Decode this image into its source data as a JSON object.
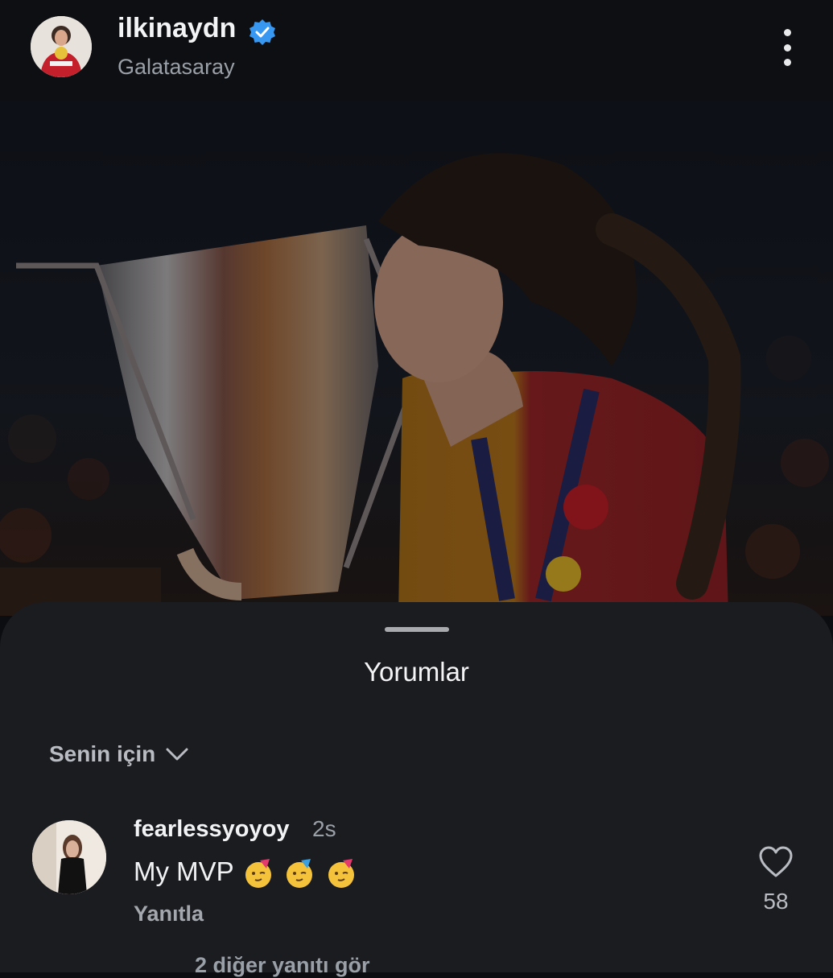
{
  "header": {
    "username": "ilkinaydn",
    "location": "Galatasaray"
  },
  "sheet": {
    "title": "Yorumlar",
    "filter_label": "Senin için"
  },
  "comment": {
    "username": "fearlessyoyoy",
    "time": "2s",
    "text": "My MVP",
    "reply_label": "Yanıtla",
    "like_count": "58"
  },
  "more_replies": "2 diğer yanıtı gör"
}
